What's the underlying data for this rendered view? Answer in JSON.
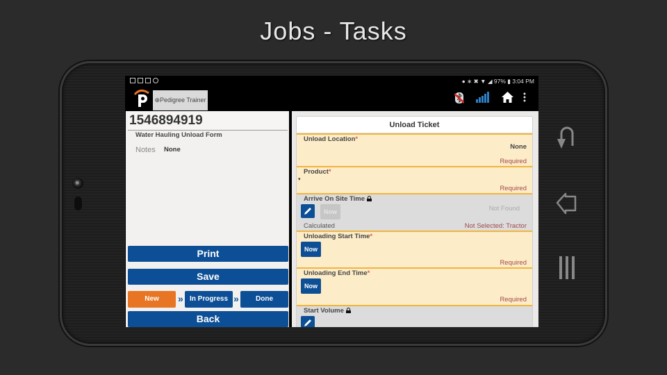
{
  "slide": {
    "title": "Jobs - Tasks"
  },
  "status_bar": {
    "left_icons": [
      "notification-icon",
      "image-icon",
      "square-icon",
      "pedigree-notification-icon"
    ],
    "right_text": "97%",
    "time": "3:04 PM"
  },
  "app_bar": {
    "tab_label": "⊕Pedigree Trainer",
    "icons": [
      "bluetooth-off-icon",
      "signal-bars-icon",
      "home-icon",
      "more-vert-icon"
    ]
  },
  "left_panel": {
    "ticket_id": "1546894919",
    "form_name": "Water Hauling Unload Form",
    "notes_label": "Notes",
    "notes_value": "None",
    "buttons": {
      "print": "Print",
      "save": "Save",
      "back": "Back"
    },
    "status_steps": [
      {
        "label": "New",
        "active": true
      },
      {
        "label": "In Progress",
        "active": false
      },
      {
        "label": "Done",
        "active": false
      }
    ],
    "step_separator": "»"
  },
  "unload_ticket": {
    "title": "Unload Ticket",
    "fields": [
      {
        "label": "Unload Location",
        "required_star": "*",
        "value": "None",
        "status": "Required"
      },
      {
        "label": "Product",
        "required_star": "*",
        "value": "▾",
        "status": "Required"
      },
      {
        "label": "Arrive On Site Time",
        "value": "Not Found",
        "now_label": "Now",
        "sub_label": "Calculated",
        "status": "Not Selected: Tractor"
      },
      {
        "label": "Unloading Start Time",
        "required_star": "*",
        "now_label": "Now",
        "status": "Required"
      },
      {
        "label": "Unloading End Time",
        "required_star": "*",
        "now_label": "Now",
        "status": "Required"
      },
      {
        "label": "Start Volume"
      }
    ]
  },
  "colors": {
    "primary_blue": "#0d4f96",
    "active_orange": "#e87524",
    "required_bg": "#fdecc8",
    "required_border": "#f0b440",
    "required_text": "#a04848"
  }
}
